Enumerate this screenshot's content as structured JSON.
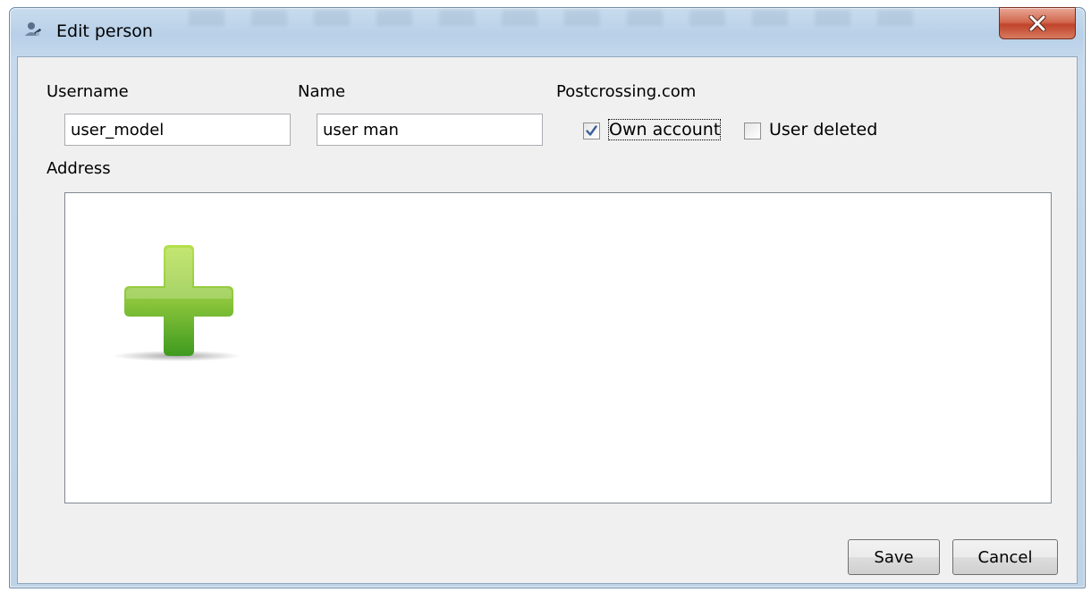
{
  "window": {
    "title": "Edit person",
    "close_label": "X"
  },
  "form": {
    "username_label": "Username",
    "username_value": "user_model",
    "name_label": "Name",
    "name_value": "user man",
    "postcrossing_label": "Postcrossing.com",
    "own_account_label": "Own account",
    "own_account_checked": true,
    "user_deleted_label": "User deleted",
    "user_deleted_checked": false,
    "address_label": "Address"
  },
  "buttons": {
    "save": "Save",
    "cancel": "Cancel"
  },
  "icons": {
    "app": "edit-person-icon",
    "add": "add-plus-icon"
  },
  "colors": {
    "plus_green_light": "#a6d83a",
    "plus_green_dark": "#3f9a1f"
  }
}
